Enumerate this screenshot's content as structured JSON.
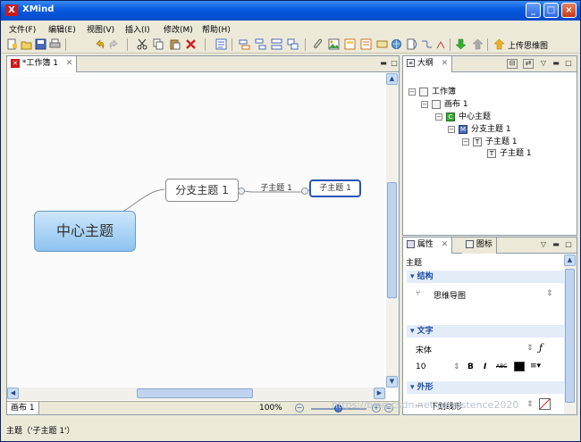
{
  "window": {
    "title": "XMind",
    "logo": "X",
    "controls": [
      "_",
      "□",
      "×"
    ]
  },
  "menu": [
    "文件(F)",
    "编辑(E)",
    "视图(V)",
    "插入(I)",
    "修改(M)",
    "帮助(H)"
  ],
  "toolbar": {
    "upload_label": "上传思维图"
  },
  "editor": {
    "tab_label": "*工作簿 1",
    "close_glyph": "✕"
  },
  "mindmap": {
    "central": "中心主题",
    "main_topic": "分支主题 1",
    "sub_topic_1": "子主题 1",
    "sub_topic_2": "子主题 1"
  },
  "sheet_tab": "画布 1",
  "zoom": "100%",
  "outline": {
    "tab_label": "大纲",
    "nodes": [
      "工作簿",
      "画布 1",
      "中心主题",
      "分支主题 1",
      "子主题 1",
      "子主题 1"
    ]
  },
  "properties": {
    "tab_label": "属性",
    "icons_tab_label": "图标",
    "subject": "主题",
    "structure_header": "结构",
    "structure_value": "思维导图",
    "text_header": "文字",
    "font_name": "宋体",
    "font_size": "10",
    "bold": "B",
    "italic": "I",
    "strike": "ABC",
    "shape_header": "外形",
    "shape_value": "下划线形"
  },
  "statusbar": {
    "message": "主题（'子主题 1'）",
    "watermark": "https://blog.csdn.net/persistence2020"
  },
  "colors": {
    "title_bar": "#0a5ce0",
    "central_fill": "#a8d2f4",
    "selected_border": "#2456b8",
    "section_header": "#1c4ea8"
  }
}
